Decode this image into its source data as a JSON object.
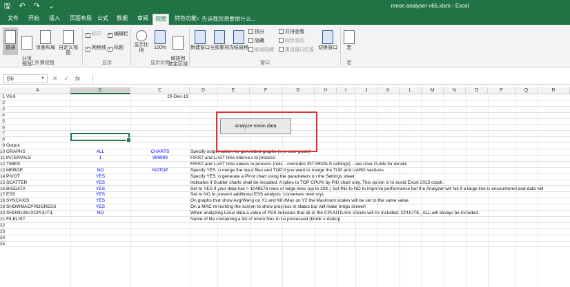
{
  "window": {
    "title": "nmon analyser v66.xlsm - Excel",
    "qat": [
      "🖫",
      "↶",
      "↷",
      "⌄"
    ]
  },
  "tabs": [
    "文件",
    "开始",
    "插入",
    "页面布局",
    "公式",
    "数据",
    "审阅",
    "视图",
    "特色功能"
  ],
  "active_tab": "视图",
  "tell_me": "♀ 告诉我您想要做什么...",
  "ribbon": {
    "workbook_views": {
      "label": "工作簿视图",
      "buttons": [
        "普通",
        "分页\n预览",
        "页面布局",
        "自定义视图"
      ]
    },
    "show": {
      "label": "显示",
      "checks": [
        {
          "label": "标尺",
          "checked": true,
          "disabled": true
        },
        {
          "label": "编辑栏",
          "checked": true,
          "disabled": false
        },
        {
          "label": "网格线",
          "checked": true,
          "disabled": false
        },
        {
          "label": "标题",
          "checked": true,
          "disabled": false
        }
      ]
    },
    "zoom": {
      "label": "显示比例",
      "buttons": [
        "显示比例",
        "100%",
        "缩放到\n选定区域"
      ]
    },
    "window": {
      "label": "窗口",
      "buttons": [
        "新建窗口",
        "全部重排",
        "冻结窗格"
      ],
      "small": [
        {
          "label": "拆分",
          "disabled": false
        },
        {
          "label": "隐藏",
          "disabled": false
        },
        {
          "label": "取消隐藏",
          "disabled": true
        },
        {
          "label": "并排查看",
          "disabled": false
        },
        {
          "label": "同步滚动",
          "disabled": true
        },
        {
          "label": "重设窗口位置",
          "disabled": true
        }
      ],
      "switch": "切换窗口"
    },
    "macros": {
      "label": "宏",
      "button": "宏"
    }
  },
  "formula_bar": {
    "name_box": "B6",
    "cancel": "✕",
    "enter": "✓",
    "fx": "fx",
    "value": ""
  },
  "columns": [
    "A",
    "B",
    "C",
    "D",
    "E",
    "F",
    "G",
    "H",
    "I",
    "J",
    "K",
    "L",
    "M",
    "N",
    "O",
    "P",
    "Q",
    "R"
  ],
  "selected_column": "B",
  "rows": [
    {
      "n": "1",
      "a": "V6.6",
      "b": "",
      "c": "20-Dec-19",
      "d": ""
    },
    {
      "n": "2",
      "a": "",
      "b": "",
      "c": "",
      "d": ""
    },
    {
      "n": "3",
      "a": "",
      "b": "",
      "c": "",
      "d": ""
    },
    {
      "n": "4",
      "a": "",
      "b": "",
      "c": "",
      "d": ""
    },
    {
      "n": "5",
      "a": "",
      "b": "",
      "c": "",
      "d": ""
    },
    {
      "n": "6",
      "a": "",
      "b": "",
      "c": "",
      "d": ""
    },
    {
      "n": "7",
      "a": "",
      "b": "",
      "c": "",
      "d": ""
    },
    {
      "n": "8",
      "a": "",
      "b": "",
      "c": "",
      "d": ""
    },
    {
      "n": "9",
      "a": "Output",
      "b": "",
      "c": "",
      "d": ""
    },
    {
      "n": "10",
      "a": "GRAPHS",
      "b": "ALL",
      "c": "CHARTS",
      "d": "Specify output option for generated graphs (see user guide)"
    },
    {
      "n": "11",
      "a": "INTERVALS",
      "b": "1",
      "c": "999999",
      "d": "FIRST and LAST time intervals to process"
    },
    {
      "n": "12",
      "a": "TIMES",
      "b": "",
      "c": "",
      "d": "FIRST and LAST time values to process (note - overrides INTERVALS settings) - see User Guide for details"
    },
    {
      "n": "13",
      "a": "MERGE",
      "b": "NO",
      "c": "NOTOP",
      "d": "Specify YES to merge the input files and TOP if you want to merge the TOP and UARG sections"
    },
    {
      "n": "14",
      "a": "PIVOT",
      "b": "YES",
      "c": "",
      "d": "Specify YES to generate a Pivot chart using the parameters on the Settings sheet"
    },
    {
      "n": "15",
      "a": "SCATTER",
      "b": "YES",
      "c": "",
      "d": "Indicates if Scatter charts shall be included.  Applies to TOP CPU% by PID chart only.  This option is to avoid Excel 2013 crash."
    },
    {
      "n": "16",
      "a": "BIGDATA",
      "b": "YES",
      "c": "",
      "d": "Set to YES if your data has > 1048576 rows or large lines (up to 32K.)  Set this to NO to improve performance but the Analyzer will fail if a large line is encountered and data will"
    },
    {
      "n": "17",
      "a": "ESS",
      "b": "YES",
      "c": "",
      "d": "Set to NO to prevent additional ESS analysis (conserves memory)"
    },
    {
      "n": "18",
      "a": "SYNCAXIS",
      "b": "YES",
      "c": "",
      "d": "On graphs that show Avg/Wavg on Y1 and Min/Max on Y2 the Maximum scales will be set to the same value"
    },
    {
      "n": "19",
      "a": "SHOWMACPROGRESS",
      "b": "YES",
      "c": "",
      "d": "On a MAC refreshing the screen to show progress in status bar will make trings slower!"
    },
    {
      "n": "20",
      "a": "SHOWLINUXCPUUTIL",
      "b": "NO",
      "c": "",
      "d": "When analyzing Linux data a value of YES indicates that all of the CPUUTILnnn sheets will be included.  CPUUTIL_ALL will always be included."
    },
    {
      "n": "21",
      "a": "FILELIST",
      "b": "",
      "c": "",
      "d": "Name of file containing a list of nmon files to be processed (blank = dialog)"
    },
    {
      "n": "22",
      "a": "",
      "b": "",
      "c": "",
      "d": ""
    },
    {
      "n": "23",
      "a": "",
      "b": "",
      "c": "",
      "d": ""
    },
    {
      "n": "24",
      "a": "",
      "b": "",
      "c": "",
      "d": ""
    },
    {
      "n": "25",
      "a": "",
      "b": "",
      "c": "",
      "d": ""
    }
  ],
  "analyze_button": "Analyze nmon data",
  "colors": {
    "excel_green": "#217346",
    "value_blue": "#0000ff",
    "highlight_red": "#e03131"
  }
}
